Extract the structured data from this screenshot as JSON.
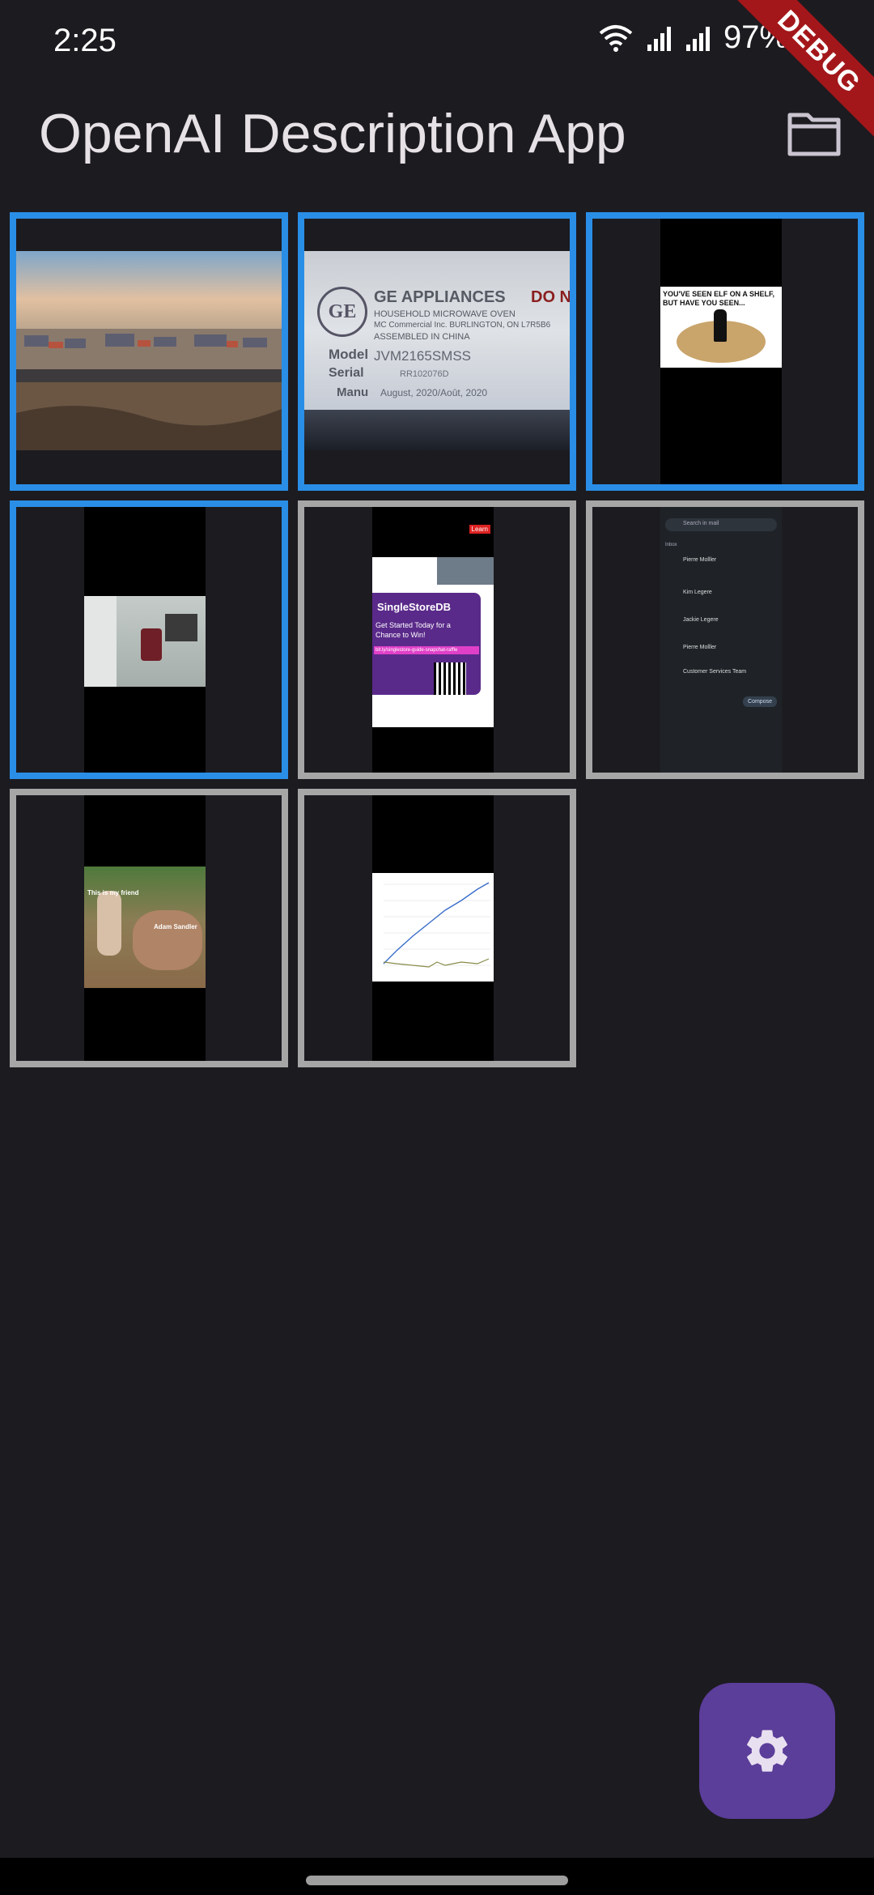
{
  "status_bar": {
    "time": "2:25",
    "battery_pct": "97%"
  },
  "debug_banner": "DEBUG",
  "app_bar": {
    "title": "OpenAI Description App",
    "action_icon": "folder-icon"
  },
  "grid": {
    "selection_color": "#2a8ee6",
    "default_border": "#a6a6a6",
    "tiles": [
      {
        "selected": true
      },
      {
        "selected": true,
        "label_brand": "GE APPLIANCES",
        "label_line1": "HOUSEHOLD MICROWAVE OVEN",
        "label_line2": "MC Commercial Inc. BURLINGTON, ON L7R5B6",
        "label_line3": "ASSEMBLED IN CHINA",
        "model_label": "Model",
        "model": "JVM2165SMSS",
        "serial_label": "Serial",
        "serial": "RR102076D",
        "manu_label": "Manu",
        "manu": "August, 2020/Août, 2020",
        "right_text": "DO N"
      },
      {
        "selected": true,
        "meme_text": "YOU'VE SEEN ELF ON A SHELF, BUT HAVE YOU SEEN..."
      },
      {
        "selected": true
      },
      {
        "selected": false,
        "brand": "SingleStoreDB",
        "headline": "Get Started Today for a Chance to Win!",
        "link_text": "bit.ly/singlestore-guide-snapchat-raffle",
        "learn": "Learn"
      },
      {
        "selected": false,
        "search_placeholder": "Search in mail",
        "section": "Inbox",
        "senders": [
          "Pierre Molller",
          "Kim Legere",
          "Jackie Legere",
          "Pierre Molller",
          "Customer Services Team"
        ],
        "compose": "Compose"
      },
      {
        "selected": false,
        "caption_top": "This is my friend",
        "caption_bottom": "Adam Sandler"
      },
      {
        "selected": false
      }
    ]
  },
  "fab": {
    "icon": "settings-gear-icon",
    "color": "#5b3d9a"
  }
}
